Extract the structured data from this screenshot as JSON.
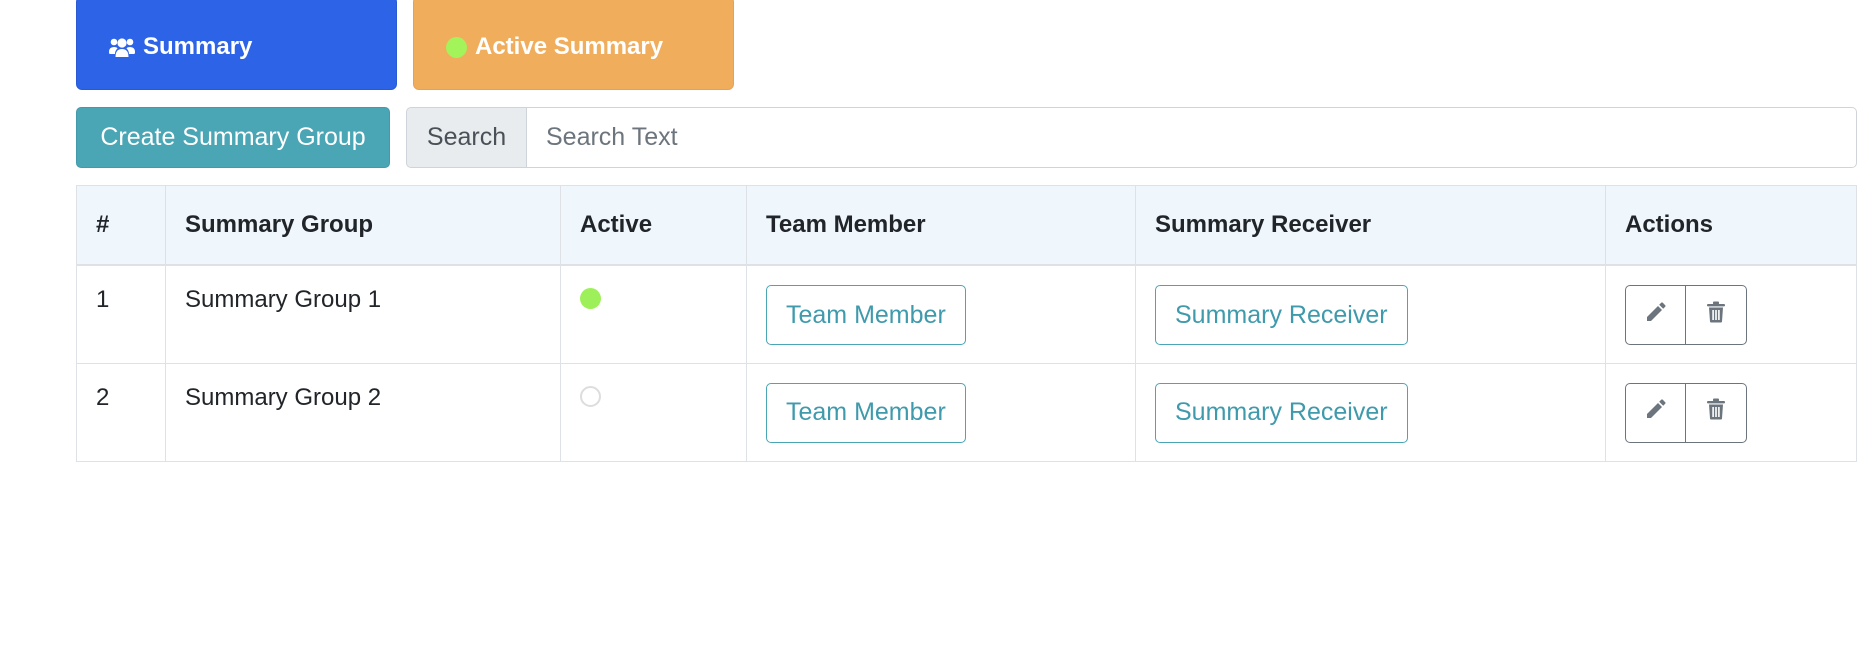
{
  "tabs": {
    "summary_label": "Summary",
    "active_summary_label": "Active Summary"
  },
  "toolbar": {
    "create_label": "Create Summary Group",
    "search_label": "Search",
    "search_placeholder": "Search Text"
  },
  "table": {
    "headers": [
      "#",
      "Summary Group",
      "Active",
      "Team Member",
      "Summary Receiver",
      "Actions"
    ],
    "rows": [
      {
        "num": "1",
        "group": "Summary Group 1",
        "active": true,
        "team_label": "Team Member",
        "receiver_label": "Summary Receiver"
      },
      {
        "num": "2",
        "group": "Summary Group 2",
        "active": false,
        "team_label": "Team Member",
        "receiver_label": "Summary Receiver"
      }
    ]
  },
  "colors": {
    "primary": "#2d63e6",
    "warning": "#f0ae5d",
    "info": "#4aa5b5",
    "active_dot": "#9ef05a"
  },
  "icons": {
    "summary_tab": "users-icon",
    "active_tab": "green-dot-icon",
    "edit": "pencil-icon",
    "delete": "trash-icon"
  }
}
